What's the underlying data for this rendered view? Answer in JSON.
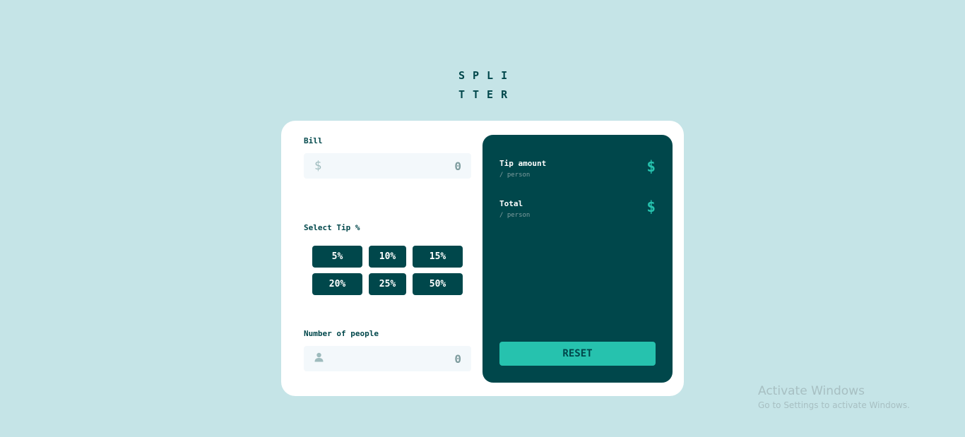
{
  "logo": {
    "line1": "SPLI",
    "line2": "TTER"
  },
  "bill": {
    "label": "Bill",
    "currency_symbol": "$",
    "placeholder": "0"
  },
  "tip": {
    "label": "Select Tip %",
    "options": [
      "5%",
      "10%",
      "15%",
      "20%",
      "25%",
      "50%"
    ]
  },
  "people": {
    "label": "Number of people",
    "icon": "person-icon",
    "placeholder": "0"
  },
  "results": {
    "tip_amount": {
      "title": "Tip amount",
      "subtitle": "/ person",
      "value": "$"
    },
    "total": {
      "title": "Total",
      "subtitle": "/ person",
      "value": "$"
    },
    "reset_label": "RESET"
  },
  "watermark": {
    "title": "Activate Windows",
    "subtitle": "Go to Settings to activate Windows."
  },
  "colors": {
    "background": "#c5e4e7",
    "dark_cyan": "#00474b",
    "strong_cyan": "#26c2ae",
    "input_bg": "#f3f8fb"
  }
}
